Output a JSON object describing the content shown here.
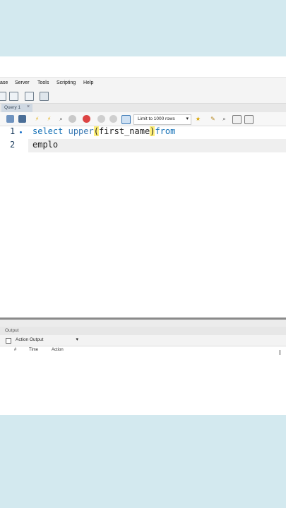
{
  "menu": {
    "items": [
      "ase",
      "Server",
      "Tools",
      "Scripting",
      "Help"
    ]
  },
  "tab": {
    "label": "Query 1",
    "close": "×"
  },
  "query_toolbar": {
    "limit_label": "Limit to 1000 rows",
    "arrow": "▾"
  },
  "editor": {
    "line_numbers": [
      "1",
      "2"
    ],
    "line1": {
      "kw_select": "select",
      "fn_upper": "upper",
      "open_paren": "(",
      "arg": "first_name",
      "close_paren": ")",
      "kw_from": "from"
    },
    "line2": "emplo",
    "caret": "I"
  },
  "output": {
    "header": "Output",
    "select_label": "Action Output",
    "arrow": "▾",
    "columns": [
      "#",
      "Time",
      "Action"
    ]
  },
  "colors": {
    "keyword": "#1370b6",
    "bracket_highlight": "#fff07a",
    "background": "#d3e9ef"
  }
}
